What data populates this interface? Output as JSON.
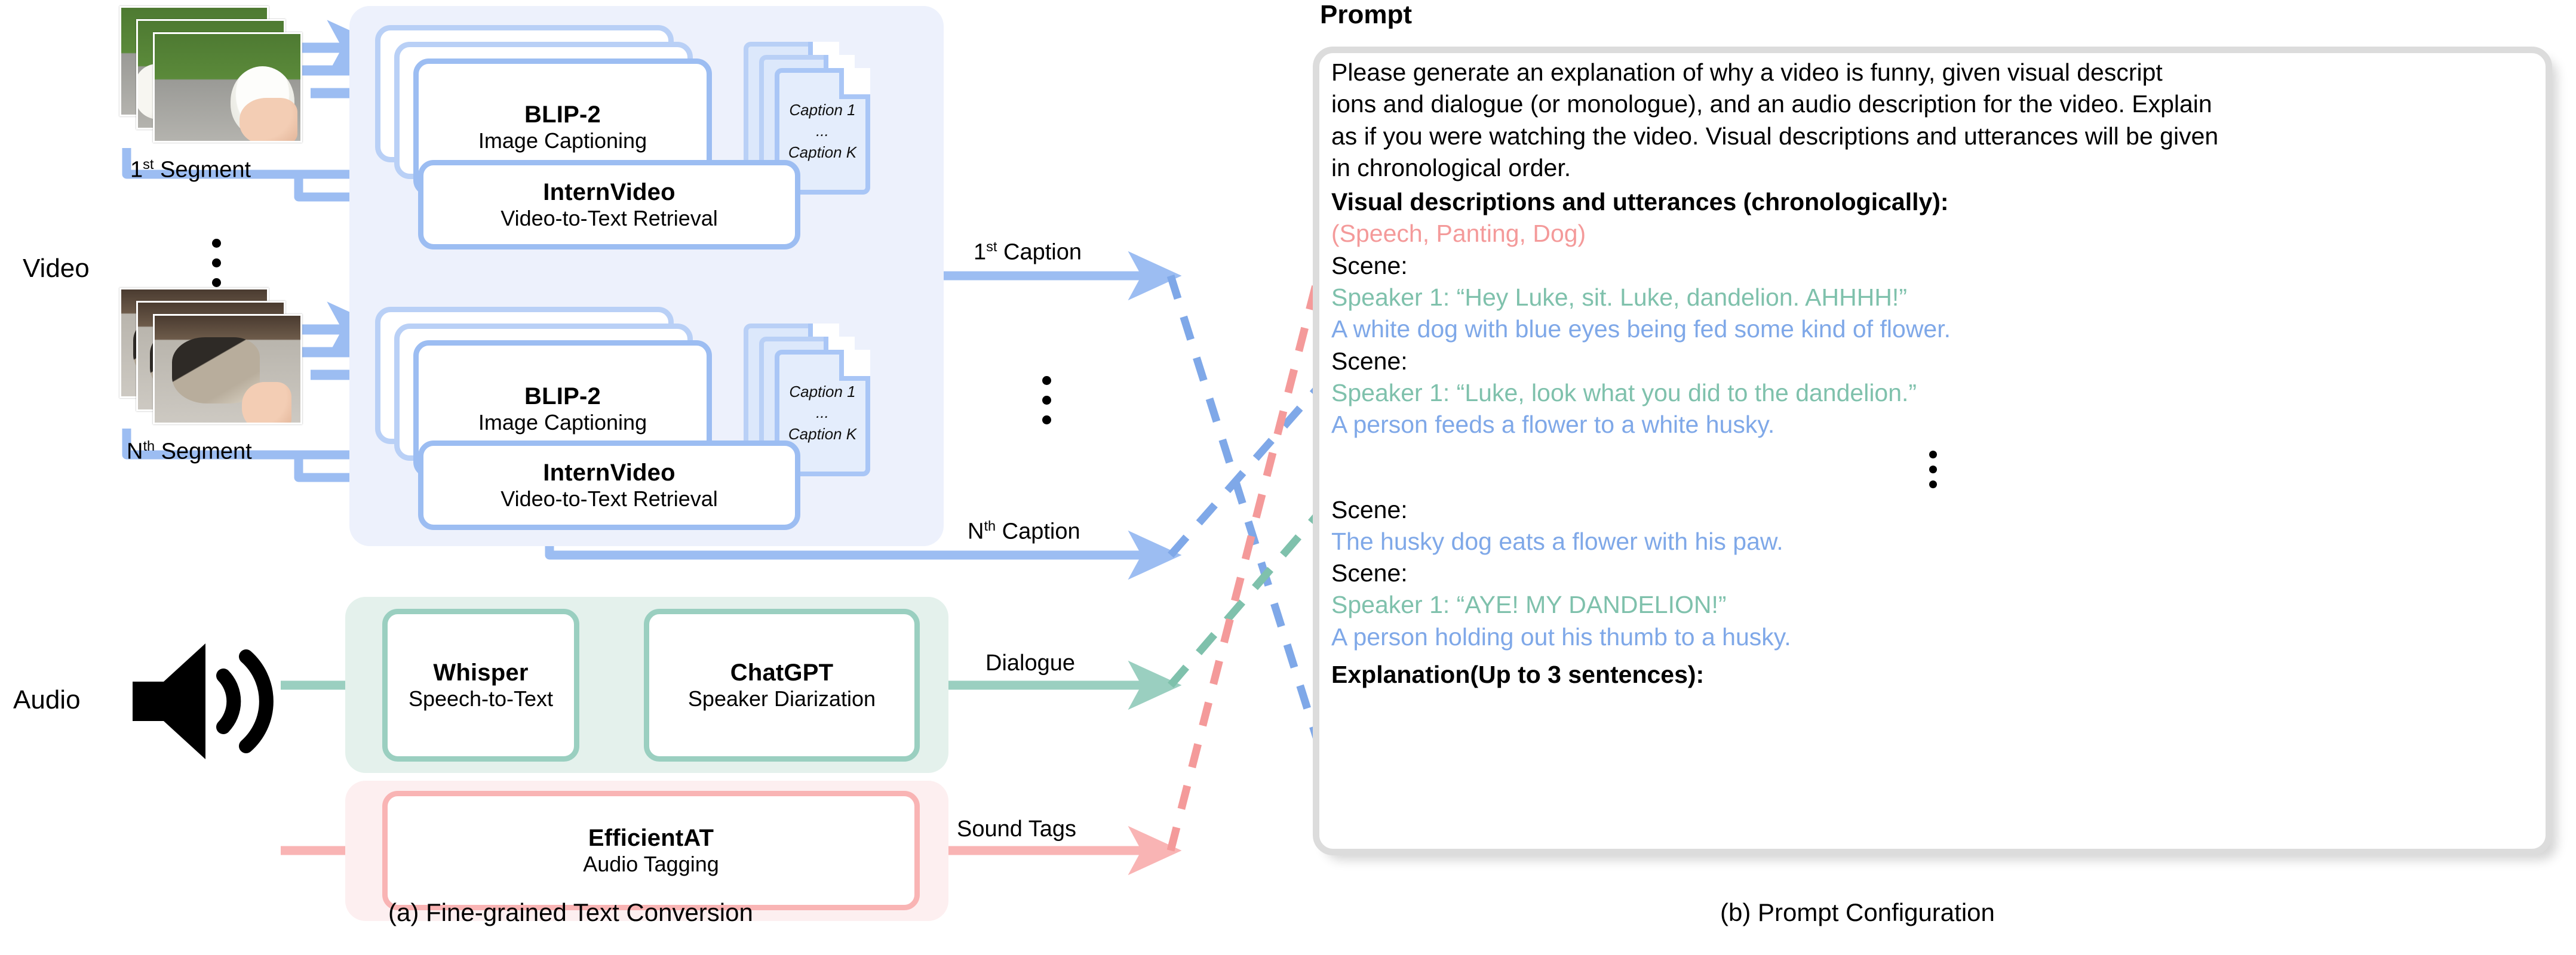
{
  "figure": {
    "caption_a": "(a)  Fine-grained Text Conversion",
    "caption_b": "(b)  Prompt Configuration"
  },
  "panel_a": {
    "input_video_label": "Video",
    "input_audio_label": "Audio",
    "segments": [
      {
        "label_prefix": "1",
        "label_sup": "st",
        "label_suffix": " Segment"
      },
      {
        "label_prefix": "N",
        "label_sup": "th",
        "label_suffix": " Segment"
      }
    ],
    "modules": {
      "blip2_title": "BLIP-2",
      "blip2_subtitle": "Image Captioning",
      "internvideo_title": "InternVideo",
      "internvideo_subtitle": "Video-to-Text Retrieval",
      "whisper_title": "Whisper",
      "whisper_subtitle": "Speech-to-Text",
      "chatgpt_title": "ChatGPT",
      "chatgpt_subtitle": "Speaker Diarization",
      "efficientat_title": "EfficientAT",
      "efficientat_subtitle": "Audio Tagging"
    },
    "caption_doc": {
      "first": "Caption 1",
      "ellipsis": "...",
      "last": "Caption K"
    },
    "outputs": {
      "caption_first_prefix": "1",
      "caption_first_sup": "st",
      "caption_first_suffix": " Caption",
      "caption_last_prefix": "N",
      "caption_last_sup": "th",
      "caption_last_suffix": " Caption",
      "dialogue": "Dialogue",
      "sound_tags": "Sound Tags"
    },
    "colors": {
      "video_flow": "#9cbdf2",
      "video_panel_bg": "#edf1fc",
      "speech_flow": "#9acfc0",
      "speech_panel_bg": "#e4f1ec",
      "sound_flow": "#f9b4b4",
      "sound_panel_bg": "#fdeff0"
    }
  },
  "panel_b": {
    "title": "Prompt",
    "instruction": "Please generate an explanation of why a video is funny, given visual descript\nions and dialogue (or monologue), and an audio description for the video. Explain\nas if you were watching the video. Visual descriptions and utterances will be given\nin chronological order.",
    "section_header": "Visual descriptions and utterances (chronologically):",
    "lines": [
      {
        "kind": "sound",
        "text": "(Speech, Panting, Dog)"
      },
      {
        "kind": "scene",
        "text": "Scene:"
      },
      {
        "kind": "speech",
        "text": "Speaker 1: “Hey Luke, sit. Luke, dandelion. AHHHH!”"
      },
      {
        "kind": "visual",
        "text": "A white dog with blue eyes being fed some kind of flower."
      },
      {
        "kind": "scene",
        "text": "Scene:"
      },
      {
        "kind": "speech",
        "text": "Speaker 1: “Luke, look what you did to the dandelion.”"
      },
      {
        "kind": "visual",
        "text": "A person feeds a flower to a white husky."
      },
      {
        "kind": "ellipsis",
        "text": ""
      },
      {
        "kind": "scene",
        "text": "Scene:"
      },
      {
        "kind": "visual",
        "text": "The husky dog eats a flower with his paw."
      },
      {
        "kind": "scene",
        "text": "Scene:"
      },
      {
        "kind": "speech",
        "text": "Speaker 1: “AYE! MY DANDELION!”"
      },
      {
        "kind": "visual",
        "text": "A person holding out his thumb to a husky."
      }
    ],
    "footer": "Explanation(Up to 3 sentences):",
    "colors": {
      "sound_tag_text": "#f49a9a",
      "speech_text": "#7fc1ac",
      "visual_text": "#7fa8e8",
      "scene_text": "#000000",
      "box_border": "#dcdcdc"
    }
  }
}
